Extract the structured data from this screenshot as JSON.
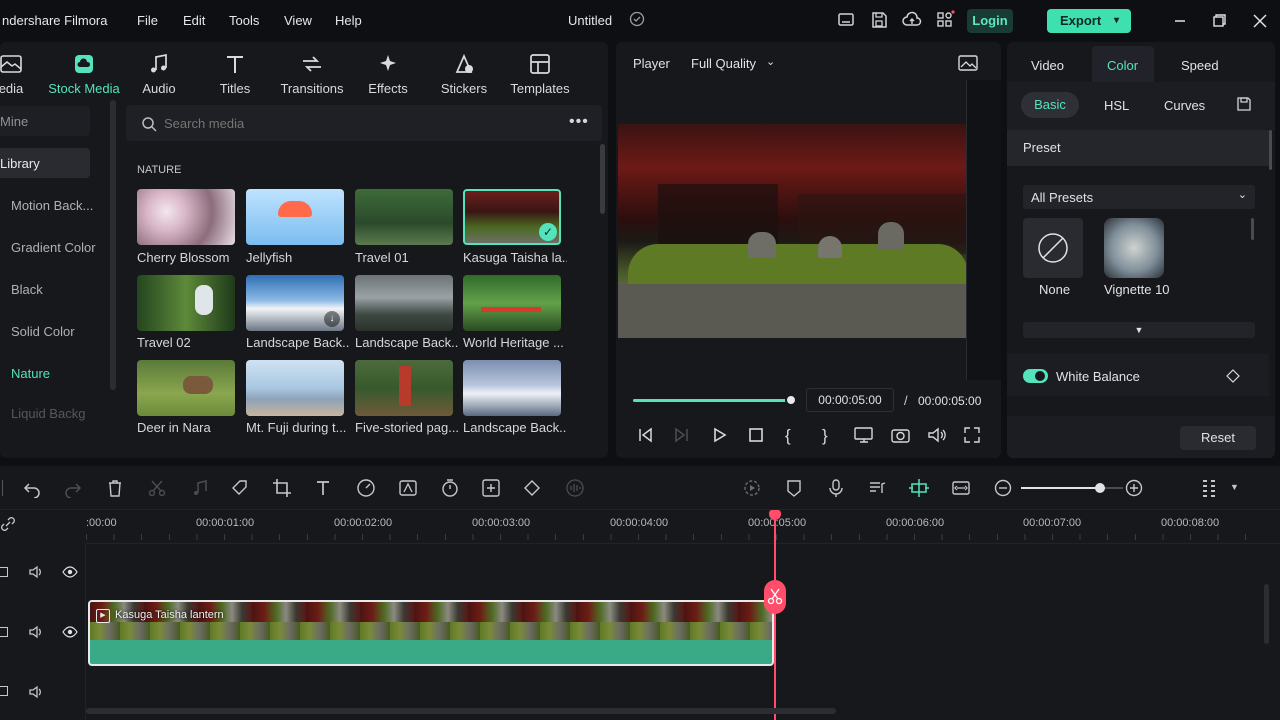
{
  "app": {
    "title": "ndershare Filmora",
    "menu": [
      "File",
      "Edit",
      "Tools",
      "View",
      "Help"
    ],
    "project": "Untitled",
    "login": "Login",
    "export": "Export"
  },
  "media_tabs": [
    {
      "label": "edia"
    },
    {
      "label": "Stock Media"
    },
    {
      "label": "Audio"
    },
    {
      "label": "Titles"
    },
    {
      "label": "Transitions"
    },
    {
      "label": "Effects"
    },
    {
      "label": "Stickers"
    },
    {
      "label": "Templates"
    }
  ],
  "sidebar": [
    "Mine",
    "Library",
    "Motion Back...",
    "Gradient Color",
    "Black",
    "Solid Color",
    "Nature",
    "Liquid Backg"
  ],
  "search": {
    "placeholder": "Search media"
  },
  "section": "NATURE",
  "thumbs": [
    "Cherry Blossom",
    "Jellyfish",
    "Travel 01",
    "Kasuga Taisha la...",
    "Travel 02",
    "Landscape Back...",
    "Landscape Back...",
    "World Heritage ...",
    "Deer in Nara",
    "Mt. Fuji during t...",
    "Five-storied pag...",
    "Landscape Back..."
  ],
  "player": {
    "label": "Player",
    "quality": "Full Quality",
    "current": "00:00:05:00",
    "sep": "/",
    "total": "00:00:05:00",
    "progress": 1.0
  },
  "props": {
    "tabs": [
      "Video",
      "Color",
      "Speed"
    ],
    "subtabs": [
      "Basic",
      "HSL",
      "Curves"
    ],
    "preset_title": "Preset",
    "preset_dropdown": "All Presets",
    "presets": [
      "None",
      "Vignette 10"
    ],
    "white_balance": "White Balance",
    "reset": "Reset"
  },
  "timeline": {
    "ticks": [
      ":00:00",
      "00:00:01:00",
      "00:00:02:00",
      "00:00:03:00",
      "00:00:04:00",
      "00:00:05:00",
      "00:00:06:00",
      "00:00:07:00",
      "00:00:08:00"
    ],
    "clip": "Kasuga Taisha lantern",
    "zoom": 0.77
  },
  "colors": {
    "accent": "#53e3bd",
    "playhead": "#ff4d6a",
    "clip": "#3aa985"
  }
}
